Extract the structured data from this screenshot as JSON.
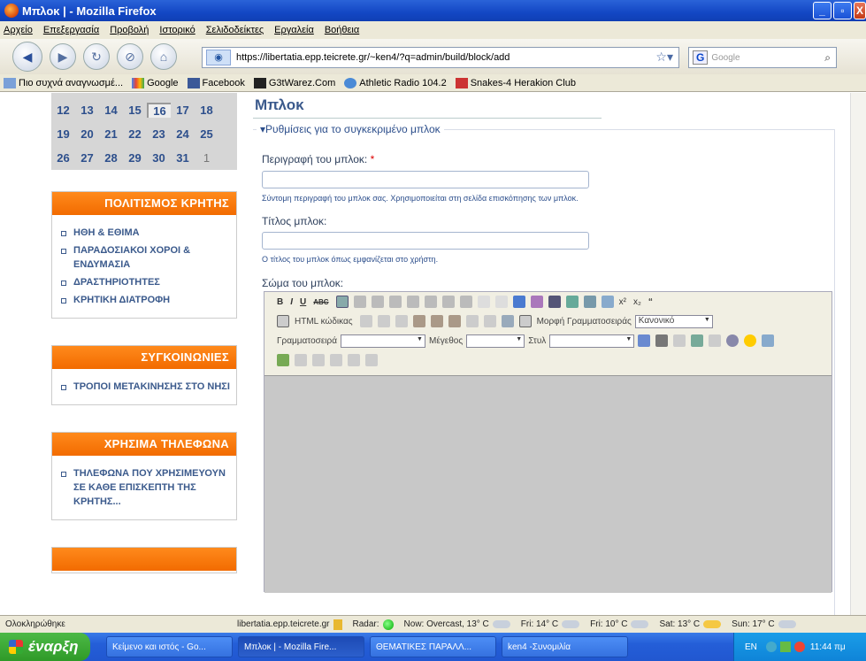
{
  "window": {
    "title": "Μπλοκ | - Mozilla Firefox"
  },
  "menu": [
    "Αρχείο",
    "Επεξεργασία",
    "Προβολή",
    "Ιστορικό",
    "Σελιδοδείκτες",
    "Εργαλεία",
    "Βοήθεια"
  ],
  "nav": {
    "url": "https://libertatia.epp.teicrete.gr/~ken4/?q=admin/build/block/add",
    "search_placeholder": "Google"
  },
  "bookmarks": [
    "Πιο συχνά αναγνωσμέ...",
    "Google",
    "Facebook",
    "G3tWarez.Com",
    "Athletic Radio 104.2",
    "Snakes-4 Herakion Club"
  ],
  "calendar": {
    "rows": [
      [
        "12",
        "13",
        "14",
        "15",
        "16",
        "17",
        "18"
      ],
      [
        "19",
        "20",
        "21",
        "22",
        "23",
        "24",
        "25"
      ],
      [
        "26",
        "27",
        "28",
        "29",
        "30",
        "31",
        "1"
      ]
    ],
    "today": "16"
  },
  "blocks": [
    {
      "title": "ΠΟΛΙΤΙΣΜΟΣ ΚΡΗΤΗΣ",
      "items": [
        "ΗΘΗ & ΕΘΙΜΑ",
        "ΠΑΡΑΔΟΣΙΑΚΟΙ ΧΟΡΟΙ & ΕΝΔΥΜΑΣΙΑ",
        "ΔΡΑΣΤΗΡΙΟΤΗΤΕΣ",
        "ΚΡΗΤΙΚΗ ΔΙΑΤΡΟΦΗ"
      ]
    },
    {
      "title": "ΣΥΓΚΟΙΝΩΝΙΕΣ",
      "items": [
        "ΤΡΟΠΟΙ ΜΕΤΑΚΙΝΗΣΗΣ ΣΤΟ ΝΗΣΙ"
      ]
    },
    {
      "title": "ΧΡΗΣΙΜΑ ΤΗΛΕΦΩΝΑ",
      "items": [
        "ΤΗΛΕΦΩΝΑ ΠΟΥ ΧΡΗΣΙΜΕΥΟΥΝ ΣΕ ΚΑΘΕ ΕΠΙΣΚΕΠΤΗ ΤΗΣ ΚΡΗΤΗΣ..."
      ]
    }
  ],
  "main": {
    "heading": "Μπλοκ",
    "fieldset_legend": "Ρυθμίσεις για το συγκεκριμένο μπλοκ",
    "desc_label": "Περιγραφή του μπλοκ:",
    "required_mark": "*",
    "desc_help": "Σύντομη περιγραφή του μπλοκ σας. Χρησιμοποιείται στη σελίδα επισκόπησης των μπλοκ.",
    "title_label": "Τίτλος μπλοκ:",
    "title_help": "Ο τίτλος του μπλοκ όπως εμφανίζεται στο χρήστη.",
    "body_label": "Σώμα του μπλοκ:",
    "editor": {
      "html_label": "HTML κώδικας",
      "format_label": "Μορφή Γραμματοσειράς",
      "format_value": "Κανονικό",
      "font_label": "Γραμματοσειρά",
      "size_label": "Μέγεθος",
      "style_label": "Στυλ"
    }
  },
  "status": {
    "left": "Ολοκληρώθηκε",
    "host": "libertatia.epp.teicrete.gr",
    "radar": "Radar:",
    "now": "Now: Overcast, 13° C",
    "fri1": "Fri: 14° C",
    "fri2": "Fri: 10° C",
    "sat": "Sat: 13° C",
    "sun": "Sun: 17° C"
  },
  "taskbar": {
    "start": "έναρξη",
    "tasks": [
      "Κείμενο και ιστός - Go...",
      "Μπλοκ | - Mozilla Fire...",
      "ΘΕΜΑΤΙΚΕΣ ΠΑΡΑΛΛ...",
      "ken4 -Συνομιλία"
    ],
    "lang": "EN",
    "time": "11:44 πμ"
  }
}
